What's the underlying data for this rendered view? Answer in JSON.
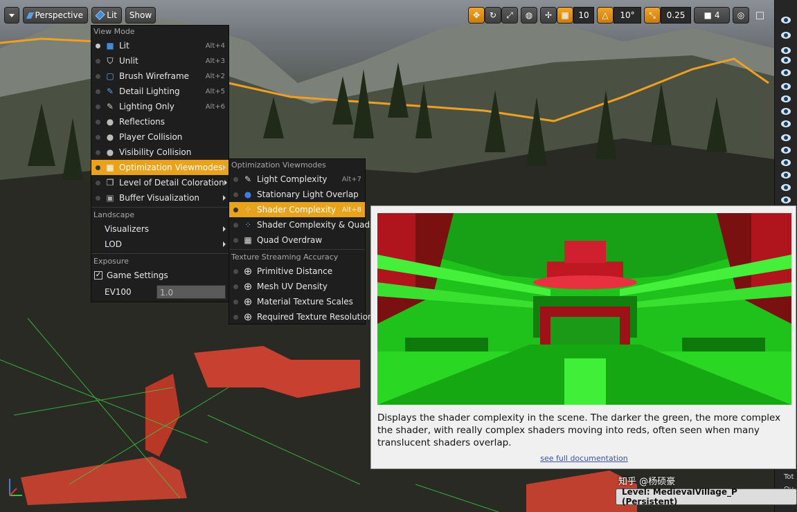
{
  "toolbar": {
    "perspective_label": "Perspective",
    "lit_label": "Lit",
    "show_label": "Show",
    "grid_snap": "10",
    "rotation_snap": "10°",
    "scale_snap": "0.25",
    "camera_speed": "4"
  },
  "view_menu": {
    "section_view_mode": "View Mode",
    "items": [
      {
        "label": "Lit",
        "shortcut": "Alt+4"
      },
      {
        "label": "Unlit",
        "shortcut": "Alt+3"
      },
      {
        "label": "Brush Wireframe",
        "shortcut": "Alt+2"
      },
      {
        "label": "Detail Lighting",
        "shortcut": "Alt+5"
      },
      {
        "label": "Lighting Only",
        "shortcut": "Alt+6"
      },
      {
        "label": "Reflections",
        "shortcut": ""
      },
      {
        "label": "Player Collision",
        "shortcut": ""
      },
      {
        "label": "Visibility Collision",
        "shortcut": ""
      },
      {
        "label": "Optimization Viewmodes",
        "shortcut": ""
      },
      {
        "label": "Level of Detail Coloration",
        "shortcut": ""
      },
      {
        "label": "Buffer Visualization",
        "shortcut": ""
      }
    ],
    "section_landscape": "Landscape",
    "visualizers_label": "Visualizers",
    "lod_label": "LOD",
    "section_exposure": "Exposure",
    "game_settings_label": "Game Settings",
    "ev100_label": "EV100",
    "ev100_value": "1.0"
  },
  "opt_menu": {
    "section_title": "Optimization Viewmodes",
    "items": [
      {
        "label": "Light Complexity",
        "shortcut": "Alt+7"
      },
      {
        "label": "Stationary Light Overlap",
        "shortcut": ""
      },
      {
        "label": "Shader Complexity",
        "shortcut": "Alt+8"
      },
      {
        "label": "Shader Complexity & Quads",
        "shortcut": ""
      },
      {
        "label": "Quad Overdraw",
        "shortcut": ""
      }
    ],
    "section_texture": "Texture Streaming Accuracy",
    "texture_items": [
      {
        "label": "Primitive Distance"
      },
      {
        "label": "Mesh UV Density"
      },
      {
        "label": "Material Texture Scales"
      },
      {
        "label": "Required Texture Resolution"
      }
    ]
  },
  "tooltip": {
    "description": "Displays the shader complexity in the scene. The darker the green, the more complex the shader, with really complex shaders moving into reds, often seen when many translucent shaders overlap.",
    "link": "see full documentation"
  },
  "status": {
    "level": "Level:  MedievalVillage_P (Persistent)",
    "watermark": "知乎 @杨硕豪",
    "side_fragment_1": "Tot",
    "side_fragment_2": "Ov"
  },
  "colors": {
    "highlight": "#e8a21c",
    "menu_bg": "#1e1e1e",
    "shader_green": "#22e01c",
    "shader_red": "#c40f18"
  }
}
